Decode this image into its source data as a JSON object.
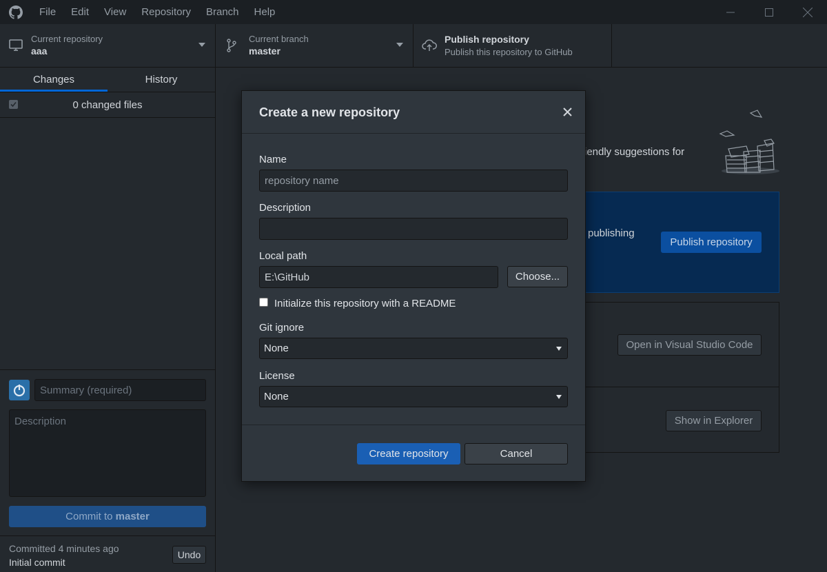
{
  "menu": [
    "File",
    "Edit",
    "View",
    "Repository",
    "Branch",
    "Help"
  ],
  "toolbar": {
    "repo_label": "Current repository",
    "repo_name": "aaa",
    "branch_label": "Current branch",
    "branch_name": "master",
    "publish_title": "Publish repository",
    "publish_subtitle": "Publish this repository to GitHub"
  },
  "tabs": {
    "changes": "Changes",
    "history": "History"
  },
  "changes": {
    "count_text": "0 changed files"
  },
  "commit": {
    "summary_placeholder": "Summary (required)",
    "description_placeholder": "Description",
    "button_prefix": "Commit to ",
    "button_branch": "master"
  },
  "last_commit": {
    "time": "Committed 4 minutes ago",
    "message": "Initial commit",
    "undo_label": "Undo"
  },
  "background": {
    "suggest_text": "riendly suggestions for",
    "publish_text": "publishing",
    "publish_button": "Publish repository",
    "open_vscode": "Open in Visual Studio Code",
    "show_explorer": "Show in Explorer"
  },
  "dialog": {
    "title": "Create a new repository",
    "name_label": "Name",
    "name_placeholder": "repository name",
    "description_label": "Description",
    "description_value": "",
    "local_path_label": "Local path",
    "local_path_value": "E:\\GitHub",
    "choose_label": "Choose...",
    "readme_label": "Initialize this repository with a README",
    "readme_checked": false,
    "gitignore_label": "Git ignore",
    "gitignore_value": "None",
    "license_label": "License",
    "license_value": "None",
    "create_label": "Create repository",
    "cancel_label": "Cancel"
  },
  "colors": {
    "background": "#24292e",
    "titlebar": "#1b1f23",
    "dialog": "#2f363d",
    "accent_blue": "#1a5fb4",
    "publish_panel": "#062a52"
  }
}
